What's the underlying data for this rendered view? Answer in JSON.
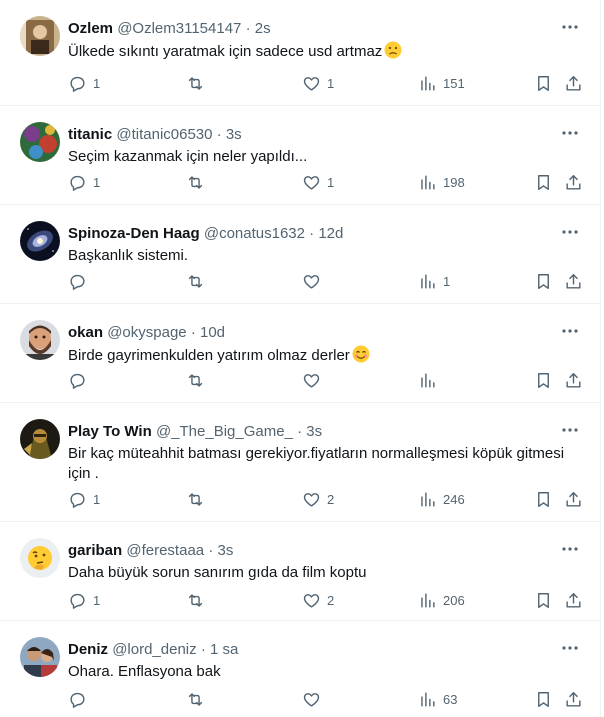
{
  "tweets": [
    {
      "name": "Ozlem",
      "handle": "@Ozlem31154147",
      "dot": "·",
      "time": "2s",
      "text": "Ülkede sıkıntı yaratmak için sadece usd artmaz",
      "emoji": "slightly-frowning-face",
      "replies": "1",
      "retweets": "",
      "likes": "1",
      "views": "151",
      "avatar": "photo-avatar"
    },
    {
      "name": "titanic",
      "handle": "@titanic06530",
      "dot": "·",
      "time": "3s",
      "text": "Seçim kazanmak için neler yapıldı...",
      "emoji": "",
      "replies": "1",
      "retweets": "",
      "likes": "1",
      "views": "198",
      "avatar": "painting-avatar"
    },
    {
      "name": "Spinoza-Den Haag",
      "handle": "@conatus1632",
      "dot": "·",
      "time": "12d",
      "text": "Başkanlık sistemi.",
      "emoji": "",
      "replies": "",
      "retweets": "",
      "likes": "",
      "views": "1",
      "avatar": "galaxy-avatar"
    },
    {
      "name": "okan",
      "handle": "@okyspage",
      "dot": "·",
      "time": "10d",
      "text": "Birde gayrimenkulden yatırım olmaz derler",
      "emoji": "smiling-face",
      "replies": "",
      "retweets": "",
      "likes": "",
      "views": "",
      "avatar": "bearded-avatar"
    },
    {
      "name": "Play To Win",
      "handle": "@_The_Big_Game_",
      "dot": "·",
      "time": "3s",
      "text": "Bir kaç müteahhit batması gerekiyor.fiyatların normalleşmesi köpük gitmesi için .",
      "emoji": "",
      "replies": "1",
      "retweets": "",
      "likes": "2",
      "views": "246",
      "avatar": "warrior-avatar"
    },
    {
      "name": "gariban",
      "handle": "@ferestaaa",
      "dot": "·",
      "time": "3s",
      "text": "Daha büyük sorun sanırım gıda da film koptu",
      "emoji": "",
      "replies": "1",
      "retweets": "",
      "likes": "2",
      "views": "206",
      "avatar": "thinking-face-avatar"
    },
    {
      "name": "Deniz",
      "handle": "@lord_deniz",
      "dot": "·",
      "time": "1 sa",
      "text": "Ohara. Enflasyona bak",
      "emoji": "",
      "replies": "",
      "retweets": "",
      "likes": "",
      "views": "63",
      "avatar": "couple-photo-avatar"
    }
  ]
}
